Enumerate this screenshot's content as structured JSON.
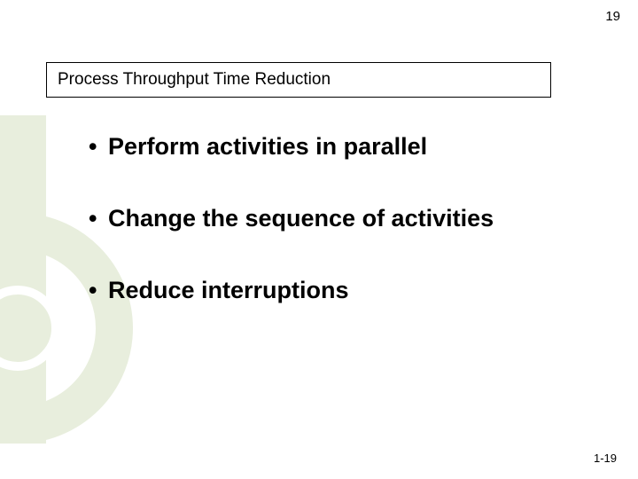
{
  "slide": {
    "page_top": "19",
    "title": "Process Throughput Time Reduction",
    "bullets": [
      "Perform activities in parallel",
      "Change the sequence of activities",
      "Reduce interruptions"
    ],
    "page_bottom": "1-19"
  }
}
